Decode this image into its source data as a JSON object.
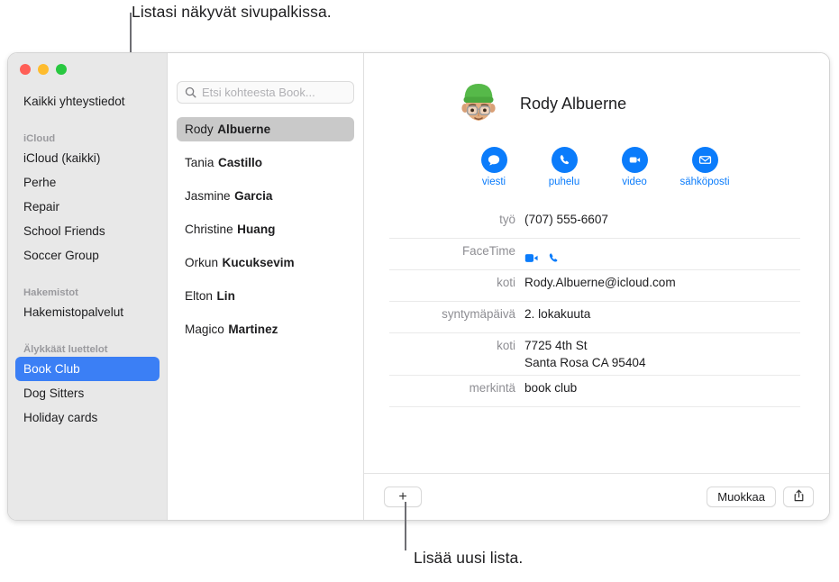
{
  "callouts": {
    "top": "Listasi näkyvät sivupalkissa.",
    "bottom": "Lisää uusi lista."
  },
  "window": {
    "traffic_lights": {
      "close": "close-button",
      "minimize": "minimize-button",
      "maximize": "maximize-button"
    }
  },
  "sidebar": {
    "all_contacts": "Kaikki yhteystiedot",
    "groups": [
      {
        "header": "iCloud",
        "items": [
          {
            "label": "iCloud (kaikki)",
            "selected": false
          },
          {
            "label": "Perhe",
            "selected": false
          },
          {
            "label": "Repair",
            "selected": false
          },
          {
            "label": "School Friends",
            "selected": false
          },
          {
            "label": "Soccer Group",
            "selected": false
          }
        ]
      },
      {
        "header": "Hakemistot",
        "items": [
          {
            "label": "Hakemistopalvelut",
            "selected": false
          }
        ]
      },
      {
        "header": "Älykkäät luettelot",
        "items": [
          {
            "label": "Book Club",
            "selected": true
          },
          {
            "label": "Dog Sitters",
            "selected": false
          },
          {
            "label": "Holiday cards",
            "selected": false
          }
        ]
      }
    ]
  },
  "search": {
    "icon": "search-icon",
    "placeholder": "Etsi kohteesta Book...",
    "value": ""
  },
  "contact_list": [
    {
      "given": "Rody",
      "family": "Albuerne",
      "selected": true
    },
    {
      "given": "Tania",
      "family": "Castillo",
      "selected": false
    },
    {
      "given": "Jasmine",
      "family": "Garcia",
      "selected": false
    },
    {
      "given": "Christine",
      "family": "Huang",
      "selected": false
    },
    {
      "given": "Orkun",
      "family": "Kucuksevim",
      "selected": false
    },
    {
      "given": "Elton",
      "family": "Lin",
      "selected": false
    },
    {
      "given": "Magico",
      "family": "Martinez",
      "selected": false
    }
  ],
  "detail": {
    "avatar": "memoji-avatar",
    "name": "Rody Albuerne",
    "actions": [
      {
        "label": "viesti",
        "icon": "message-icon"
      },
      {
        "label": "puhelu",
        "icon": "phone-icon"
      },
      {
        "label": "video",
        "icon": "video-icon"
      },
      {
        "label": "sähköposti",
        "icon": "mail-icon"
      }
    ],
    "fields": [
      {
        "label": "työ",
        "value": "(707) 555-6607",
        "type": "text"
      },
      {
        "label": "FaceTime",
        "value": "",
        "type": "facetime"
      },
      {
        "label": "koti",
        "value": "Rody.Albuerne@icloud.com",
        "type": "text"
      },
      {
        "label": "syntymäpäivä",
        "value": "2. lokakuuta",
        "type": "text"
      },
      {
        "label": "koti",
        "value": "7725 4th St\nSanta Rosa CA 95404",
        "type": "text"
      },
      {
        "label": "merkintä",
        "value": "book club",
        "type": "text"
      }
    ]
  },
  "bottom_bar": {
    "add_label": "+",
    "edit_label": "Muokkaa",
    "share_icon": "share-icon"
  },
  "colors": {
    "accent_blue": "#0b7cfb",
    "selection_blue": "#3b7ff5",
    "list_selection_gray": "#c9c9c9",
    "sidebar_bg": "#e8e8e8",
    "label_gray": "#8e8e93"
  }
}
